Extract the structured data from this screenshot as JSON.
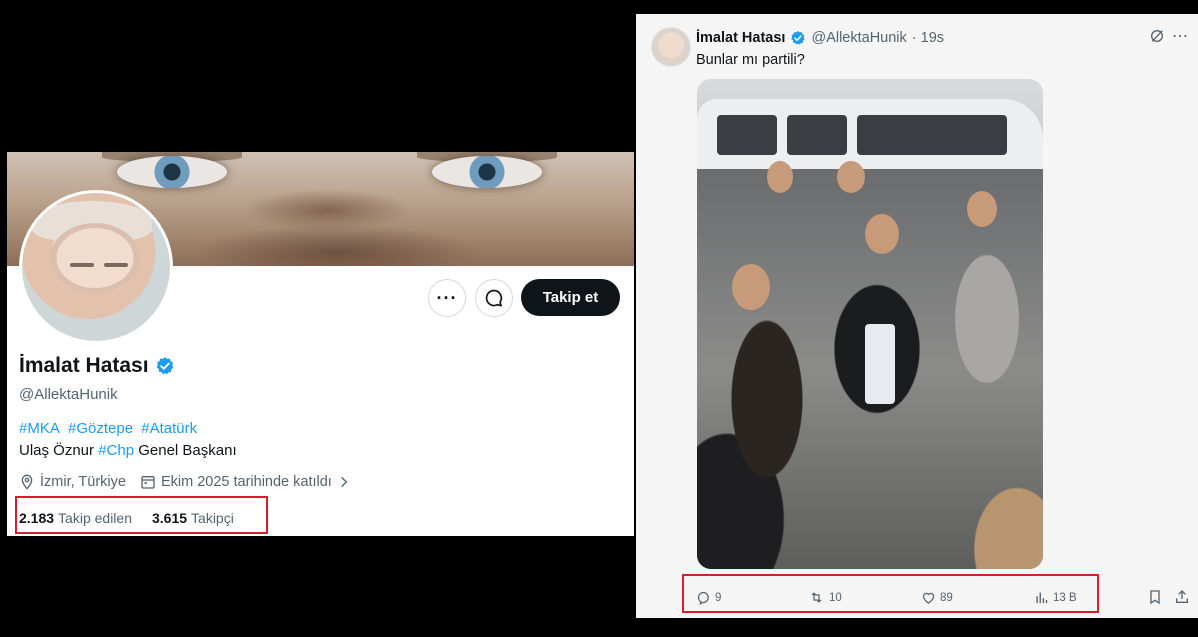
{
  "profile": {
    "name": "İmalat Hatası",
    "handle": "@AllektaHunik",
    "follow_label": "Takip et",
    "more_label": "···",
    "bio_tags": [
      "#MKA",
      "#Göztepe",
      "#Atatürk"
    ],
    "bio_line2": {
      "before": "Ulaş Öznur ",
      "tag": "#Chp",
      "after": " Genel Başkanı"
    },
    "location": "İzmir, Türkiye",
    "joined": "Ekim 2025 tarihinde katıldı",
    "following_count": "2.183",
    "following_label": "Takip edilen",
    "followers_count": "3.615",
    "followers_label": "Takipçi",
    "verified_color": "#1d9bf0",
    "icons": [
      "more-icon",
      "message-icon",
      "verified-badge-icon",
      "location-icon",
      "calendar-icon",
      "chevron-right-icon"
    ]
  },
  "tweet": {
    "name": "İmalat Hatası",
    "handle": "@AllektaHunik",
    "time": "· 19s",
    "text": "Bunlar mı partili?",
    "replies": "9",
    "retweets": "10",
    "likes": "89",
    "views": "13 B",
    "icons": [
      "grok-icon",
      "more-icon",
      "reply-icon",
      "retweet-icon",
      "like-icon",
      "views-icon",
      "bookmark-icon",
      "share-icon"
    ]
  },
  "colors": {
    "highlight": "#d41f2c",
    "link": "#1d9bf0",
    "secondary_text": "#536471",
    "button_dark": "#0f1419"
  }
}
